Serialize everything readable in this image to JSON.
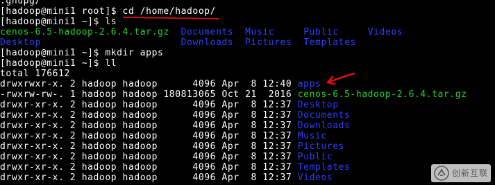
{
  "colors": {
    "background": "#000000",
    "text": "#ffffff",
    "directory": "#2e3eff",
    "archive": "#22d22a",
    "annotation": "#e01010"
  },
  "terminal": {
    "lines": [
      {
        "segments": [
          {
            "text": ".gnupg/",
            "type": "normal"
          }
        ]
      },
      {
        "segments": [
          {
            "text": "[hadoop@mini1 root]$ cd /home/hadoop/",
            "type": "normal"
          }
        ]
      },
      {
        "segments": [
          {
            "text": "[hadoop@mini1 ~]$ ls",
            "type": "normal"
          }
        ]
      },
      {
        "segments": [
          {
            "text": "cenos-6.5-hadoop-2.6.4.tar.gz",
            "type": "archive"
          },
          {
            "text": "  ",
            "type": "normal"
          },
          {
            "text": "Documents",
            "type": "dir"
          },
          {
            "text": "  ",
            "type": "normal"
          },
          {
            "text": "Music",
            "type": "dir"
          },
          {
            "text": "     ",
            "type": "normal"
          },
          {
            "text": "Public",
            "type": "dir"
          },
          {
            "text": "     ",
            "type": "normal"
          },
          {
            "text": "Videos",
            "type": "dir"
          }
        ]
      },
      {
        "segments": [
          {
            "text": "Desktop",
            "type": "dir"
          },
          {
            "text": "                        ",
            "type": "normal"
          },
          {
            "text": "Downloads",
            "type": "dir"
          },
          {
            "text": "  ",
            "type": "normal"
          },
          {
            "text": "Pictures",
            "type": "dir"
          },
          {
            "text": "  ",
            "type": "normal"
          },
          {
            "text": "Templates",
            "type": "dir"
          }
        ]
      },
      {
        "segments": [
          {
            "text": "[hadoop@mini1 ~]$ mkdir apps",
            "type": "normal"
          }
        ]
      },
      {
        "segments": [
          {
            "text": "[hadoop@mini1 ~]$ ll",
            "type": "normal"
          }
        ]
      },
      {
        "segments": [
          {
            "text": "total 176612",
            "type": "normal"
          }
        ]
      },
      {
        "segments": [
          {
            "text": "drwxrwxr-x. 2 hadoop hadoop      4096 Apr  8 12:40 ",
            "type": "normal"
          },
          {
            "text": "apps",
            "type": "dir"
          }
        ]
      },
      {
        "segments": [
          {
            "text": "-rwxrw-rw-. 1 hadoop hadoop 180813065 Oct 21  2016 ",
            "type": "normal"
          },
          {
            "text": "cenos-6.5-hadoop-2.6.4.tar.gz",
            "type": "archive"
          }
        ]
      },
      {
        "segments": [
          {
            "text": "drwxr-xr-x. 2 hadoop hadoop      4096 Apr  8 12:37 ",
            "type": "normal"
          },
          {
            "text": "Desktop",
            "type": "dir"
          }
        ]
      },
      {
        "segments": [
          {
            "text": "drwxr-xr-x. 2 hadoop hadoop      4096 Apr  8 12:37 ",
            "type": "normal"
          },
          {
            "text": "Documents",
            "type": "dir"
          }
        ]
      },
      {
        "segments": [
          {
            "text": "drwxr-xr-x. 2 hadoop hadoop      4096 Apr  8 12:37 ",
            "type": "normal"
          },
          {
            "text": "Downloads",
            "type": "dir"
          }
        ]
      },
      {
        "segments": [
          {
            "text": "drwxr-xr-x. 2 hadoop hadoop      4096 Apr  8 12:37 ",
            "type": "normal"
          },
          {
            "text": "Music",
            "type": "dir"
          }
        ]
      },
      {
        "segments": [
          {
            "text": "drwxr-xr-x. 2 hadoop hadoop      4096 Apr  8 12:37 ",
            "type": "normal"
          },
          {
            "text": "Pictures",
            "type": "dir"
          }
        ]
      },
      {
        "segments": [
          {
            "text": "drwxr-xr-x. 2 hadoop hadoop      4096 Apr  8 12:37 ",
            "type": "normal"
          },
          {
            "text": "Public",
            "type": "dir"
          }
        ]
      },
      {
        "segments": [
          {
            "text": "drwxr-xr-x. 2 hadoop hadoop      4096 Apr  8 12:37 ",
            "type": "normal"
          },
          {
            "text": "Templates",
            "type": "dir"
          }
        ]
      },
      {
        "segments": [
          {
            "text": "drwxr-xr-x. 2 hadoop hadoop      4096 Apr  8 12:37 ",
            "type": "normal"
          },
          {
            "text": "Videos",
            "type": "dir"
          }
        ]
      }
    ]
  },
  "annotations": {
    "underline_target": "cd /home/hadoop/",
    "arrow_target": "apps",
    "arrow_icon": "red-arrow-icon"
  },
  "watermark": {
    "icon": "watermark-logo-icon",
    "text": "创新互联"
  }
}
